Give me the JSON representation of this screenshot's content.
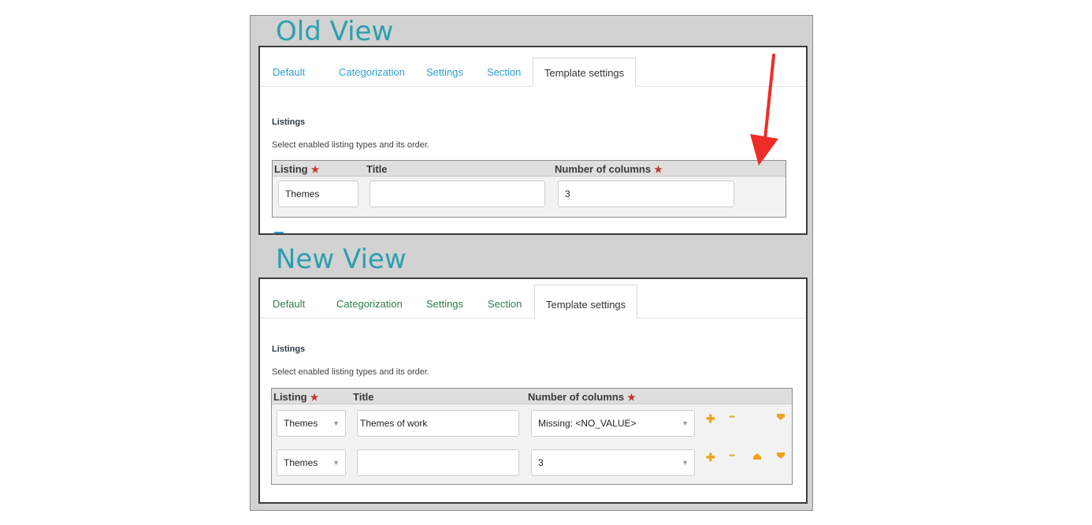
{
  "old_view": {
    "title": "Old View",
    "tabs": [
      "Default",
      "Categorization",
      "Settings",
      "Section",
      "Template settings"
    ],
    "section_title": "Listings",
    "hint": "Select enabled listing types and its order.",
    "columns": {
      "listing": "Listing",
      "title": "Title",
      "number_of_columns": "Number of columns"
    },
    "row": {
      "listing": "Themes",
      "title": "",
      "columns": "3"
    }
  },
  "new_view": {
    "title": "New View",
    "tabs": [
      "Default",
      "Categorization",
      "Settings",
      "Section",
      "Template settings"
    ],
    "section_title": "Listings",
    "hint": "Select enabled listing types and its order.",
    "columns": {
      "listing": "Listing",
      "title": "Title",
      "number_of_columns": "Number of columns"
    },
    "rows": [
      {
        "listing": "Themes",
        "title": "Themes of work",
        "columns": "Missing: <NO_VALUE>"
      },
      {
        "listing": "Themes",
        "title": "",
        "columns": "3"
      }
    ]
  },
  "colors": {
    "old_tab": "#2a9fd6",
    "new_tab": "#2e7d4f",
    "heading": "#2b9fb1",
    "arrow": "#f02c28",
    "action_icon": "#f0a21a",
    "required_star": "#c0392b"
  },
  "icons": {
    "required": "star-icon",
    "add": "plus-icon",
    "remove": "minus-icon",
    "move_up": "arrow-up-icon",
    "move_down": "arrow-down-icon",
    "annotation": "red-arrow-icon"
  },
  "symbols": {
    "star": "★",
    "plus": "✚",
    "minus": "━",
    "select_arrow": "▼"
  }
}
